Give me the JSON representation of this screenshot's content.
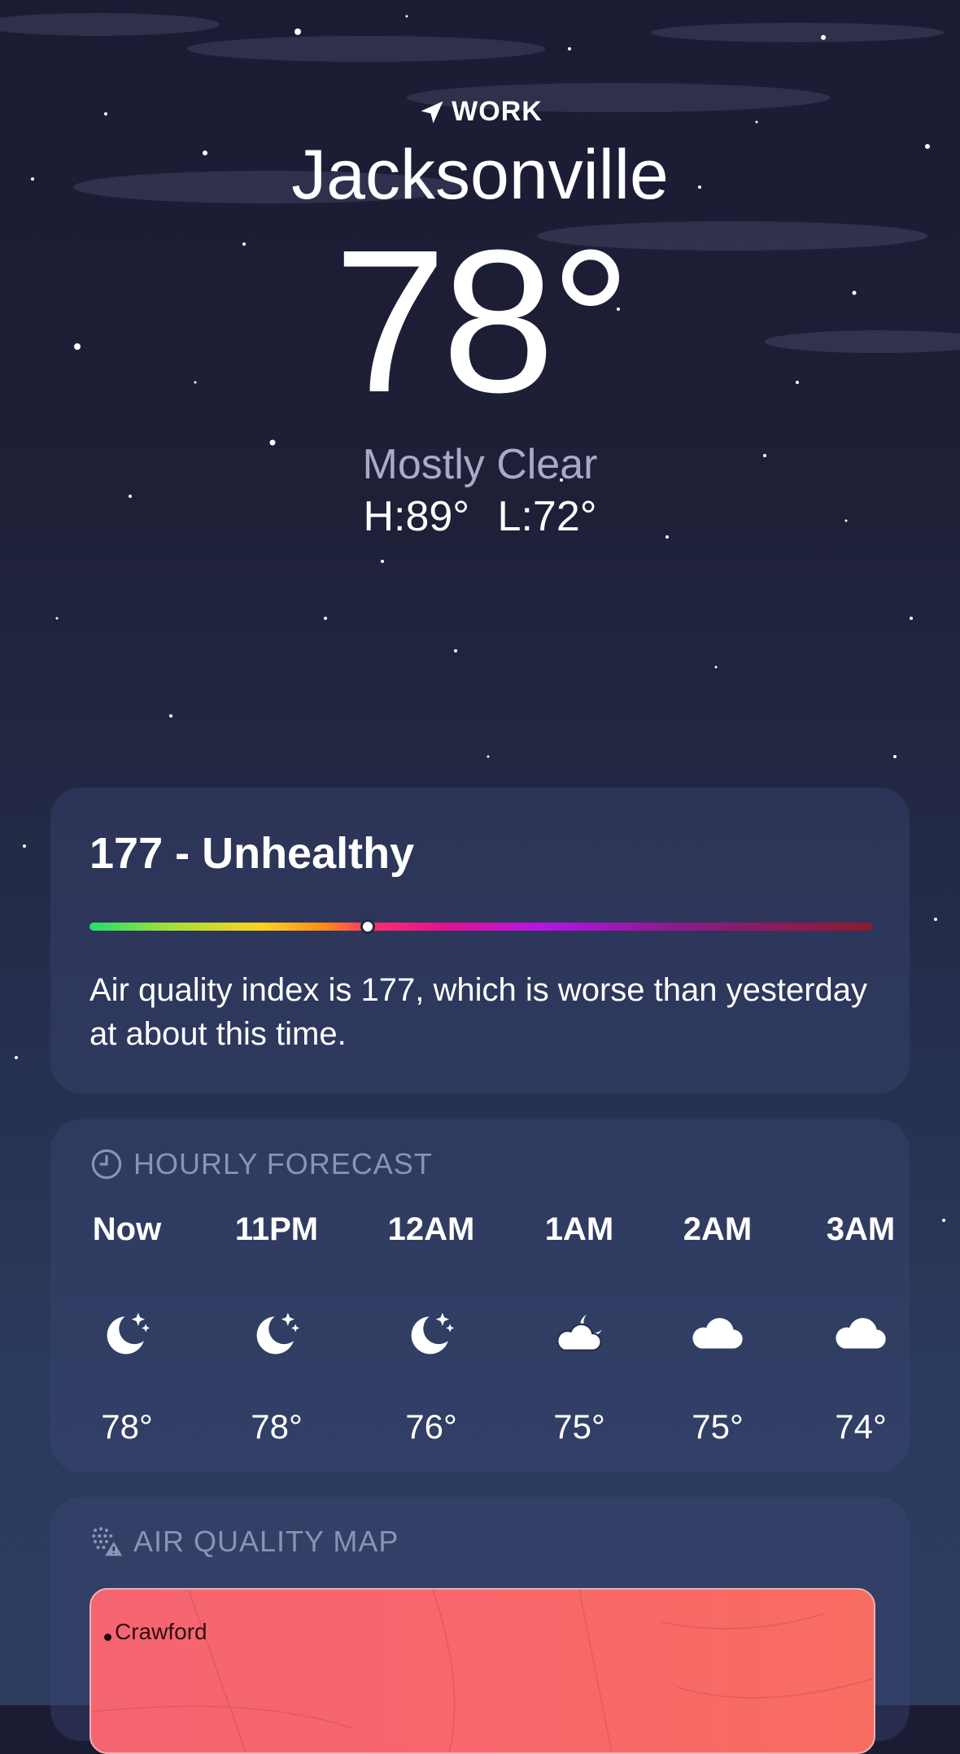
{
  "location": {
    "label": "WORK",
    "city": "Jacksonville",
    "temperature": "78°",
    "condition": "Mostly Clear",
    "high": "H:89°",
    "low": "L:72°"
  },
  "air_quality": {
    "title": "177 - Unhealthy",
    "index_value": 177,
    "scale_position": 0.355,
    "description": "Air quality index is 177, which is worse than yesterday at about this time."
  },
  "hourly": {
    "title": "HOURLY FORECAST",
    "items": [
      {
        "time": "Now",
        "icon": "moon-stars-icon",
        "temp": "78°"
      },
      {
        "time": "11PM",
        "icon": "moon-stars-icon",
        "temp": "78°"
      },
      {
        "time": "12AM",
        "icon": "moon-stars-icon",
        "temp": "76°"
      },
      {
        "time": "1AM",
        "icon": "cloud-moon-icon",
        "temp": "75°"
      },
      {
        "time": "2AM",
        "icon": "cloud-icon",
        "temp": "75°"
      },
      {
        "time": "3AM",
        "icon": "cloud-icon",
        "temp": "74°"
      }
    ]
  },
  "air_quality_map": {
    "title": "AIR QUALITY MAP",
    "place_label": "Crawford"
  },
  "colors": {
    "background_top": "#1b1b33",
    "background_bottom": "#2c3d60",
    "condition_text": "#a9abc6",
    "section_title": "#8b93b3",
    "map_fill": "#f7676b"
  }
}
